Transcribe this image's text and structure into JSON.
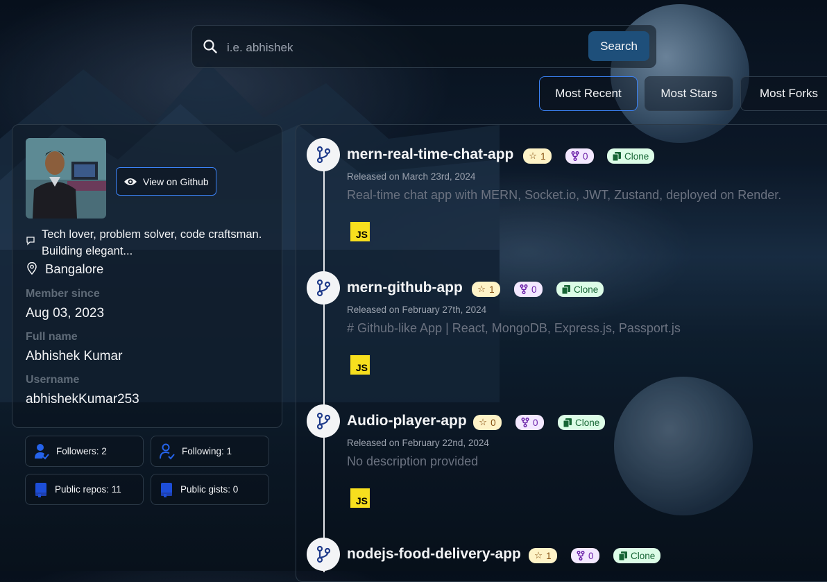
{
  "search": {
    "placeholder": "i.e. abhishek",
    "button_label": "Search"
  },
  "sort": {
    "most_recent": "Most Recent",
    "most_stars": "Most Stars",
    "most_forks": "Most Forks",
    "active": "Most Recent"
  },
  "profile": {
    "view_on_github": "View on Github",
    "bio": "Tech lover, problem solver, code craftsman. Building elegant...",
    "location": "Bangalore",
    "member_since_label": "Member since",
    "member_since": "Aug 03, 2023",
    "full_name_label": "Full name",
    "full_name": "Abhishek Kumar",
    "username_label": "Username",
    "username": "abhishekKumar253"
  },
  "stats": {
    "followers": "Followers: 2",
    "following": "Following: 1",
    "public_repos": "Public repos: 11",
    "public_gists": "Public gists: 0"
  },
  "repos": [
    {
      "name": "mern-real-time-chat-app",
      "stars": "1",
      "forks": "0",
      "clone_label": "Clone",
      "released": "Released on March 23rd, 2024",
      "description": "Real-time chat app with MERN, Socket.io, JWT, Zustand, deployed on Render.",
      "language": "JS"
    },
    {
      "name": "mern-github-app",
      "stars": "1",
      "forks": "0",
      "clone_label": "Clone",
      "released": "Released on February 27th, 2024",
      "description": "# Github-like App | React, MongoDB, Express.js, Passport.js",
      "language": "JS"
    },
    {
      "name": "Audio-player-app",
      "stars": "0",
      "forks": "0",
      "clone_label": "Clone",
      "released": "Released on February 22nd, 2024",
      "description": "No description provided",
      "language": "JS"
    },
    {
      "name": "nodejs-food-delivery-app",
      "stars": "1",
      "forks": "0",
      "clone_label": "Clone",
      "released": "",
      "description": "",
      "language": ""
    }
  ],
  "colors": {
    "accent": "#3b82f6",
    "search_button": "#1e4f7a",
    "stars_pill": "#fef3c7",
    "forks_pill": "#f3e8ff",
    "clone_pill": "#dcfce7",
    "js_logo": "#f7df1e"
  },
  "icons": {
    "search": "search-icon",
    "eye": "eye-icon",
    "bio": "speech-bubble-icon",
    "location": "map-pin-icon",
    "followers": "user-check-icon",
    "following": "user-check-outline-icon",
    "repos": "book-icon",
    "gists": "book-icon",
    "repo_badge": "git-branch-icon",
    "star": "star-icon",
    "fork": "fork-icon",
    "clone": "copy-icon",
    "language": "javascript-logo-icon"
  }
}
